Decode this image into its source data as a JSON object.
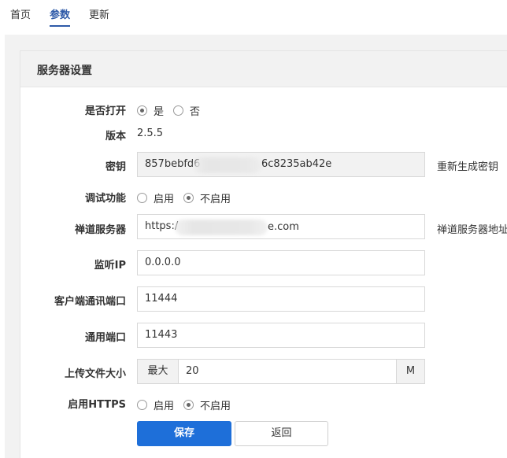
{
  "tabs": [
    {
      "label": "首页"
    },
    {
      "label": "参数"
    },
    {
      "label": "更新"
    }
  ],
  "panel": {
    "title": "服务器设置"
  },
  "form": {
    "enabled": {
      "label": "是否打开",
      "opt_yes": "是",
      "opt_no": "否",
      "selected": "是"
    },
    "version": {
      "label": "版本",
      "value": "2.5.5"
    },
    "key": {
      "label": "密钥",
      "value_start": "857bebfd6",
      "value_end": "6c8235ab42e",
      "regenerate_label": "重新生成密钥"
    },
    "debug": {
      "label": "调试功能",
      "opt_on": "启用",
      "opt_off": "不启用",
      "selected": "不启用"
    },
    "zentao_server": {
      "label": "禅道服务器",
      "value_start": "https:/",
      "value_end": "e.com",
      "hint": "禅道服务器地址"
    },
    "listen_ip": {
      "label": "监听IP",
      "value": "0.0.0.0"
    },
    "client_port": {
      "label": "客户端通讯端口",
      "value": "11444"
    },
    "common_port": {
      "label": "通用端口",
      "value": "11443"
    },
    "upload_size": {
      "label": "上传文件大小",
      "prefix": "最大",
      "value": "20",
      "unit": "M"
    },
    "https": {
      "label": "启用HTTPS",
      "opt_on": "启用",
      "opt_off": "不启用",
      "selected": "不启用"
    }
  },
  "actions": {
    "save": "保存",
    "back": "返回"
  },
  "colors": {
    "accent": "#1e6fd9",
    "tab_active": "#2e5aa8",
    "panel_bg": "#f2f2f2"
  }
}
